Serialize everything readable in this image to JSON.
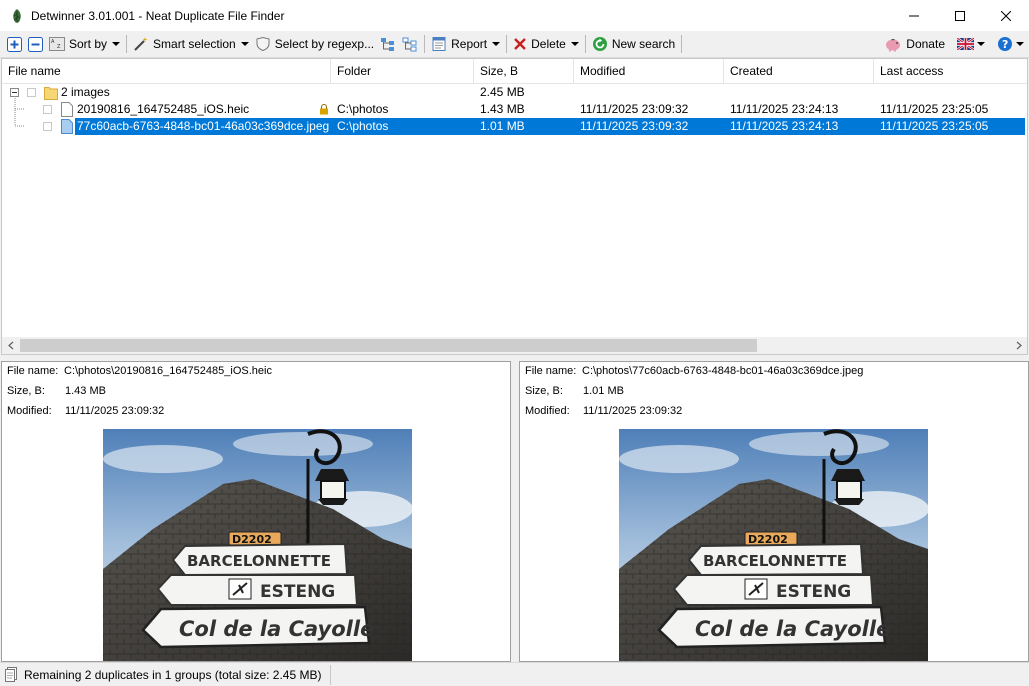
{
  "window": {
    "title": "Detwinner 3.01.001 - Neat Duplicate File Finder"
  },
  "toolbar": {
    "sort_label": "Sort by",
    "smart_selection_label": "Smart selection",
    "select_by_regexp_label": "Select by regexp...",
    "report_label": "Report",
    "delete_label": "Delete",
    "new_search_label": "New search",
    "donate_label": "Donate"
  },
  "filelist": {
    "columns": [
      "File name",
      "Folder",
      "Size, B",
      "Modified",
      "Created",
      "Last access"
    ],
    "group": {
      "name": "2 images",
      "size": "2.45 MB"
    },
    "files": [
      {
        "name": "20190816_164752485_iOS.heic",
        "folder": "C:\\photos",
        "size": "1.43 MB",
        "modified": "11/11/2025 23:09:32",
        "created": "11/11/2025 23:24:13",
        "last_access": "11/11/2025 23:25:05"
      },
      {
        "name": "77c60acb-6763-4848-bc01-46a03c369dce.jpeg",
        "folder": "C:\\photos",
        "size": "1.01 MB",
        "modified": "11/11/2025 23:09:32",
        "created": "11/11/2025 23:24:13",
        "last_access": "11/11/2025 23:25:05"
      }
    ]
  },
  "preview_labels": {
    "file_name": "File name:",
    "size": "Size, B:",
    "modified": "Modified:"
  },
  "previews": [
    {
      "file_name": "C:\\photos\\20190816_164752485_iOS.heic",
      "size": "1.43 MB",
      "modified": "11/11/2025 23:09:32"
    },
    {
      "file_name": "C:\\photos\\77c60acb-6763-4848-bc01-46a03c369dce.jpeg",
      "size": "1.01 MB",
      "modified": "11/11/2025 23:09:32"
    }
  ],
  "photo_signs": {
    "road_number": "D2202",
    "sign1": "BARCELONNETTE",
    "sign2": "ESTENG",
    "sign3": "Col de la Cayolle"
  },
  "statusbar": {
    "text": "Remaining 2 duplicates in 1 groups (total size: 2.45 MB)"
  },
  "colors": {
    "selection": "#0078d7",
    "folder": "#f7d674",
    "help": "#1a6fd1"
  }
}
